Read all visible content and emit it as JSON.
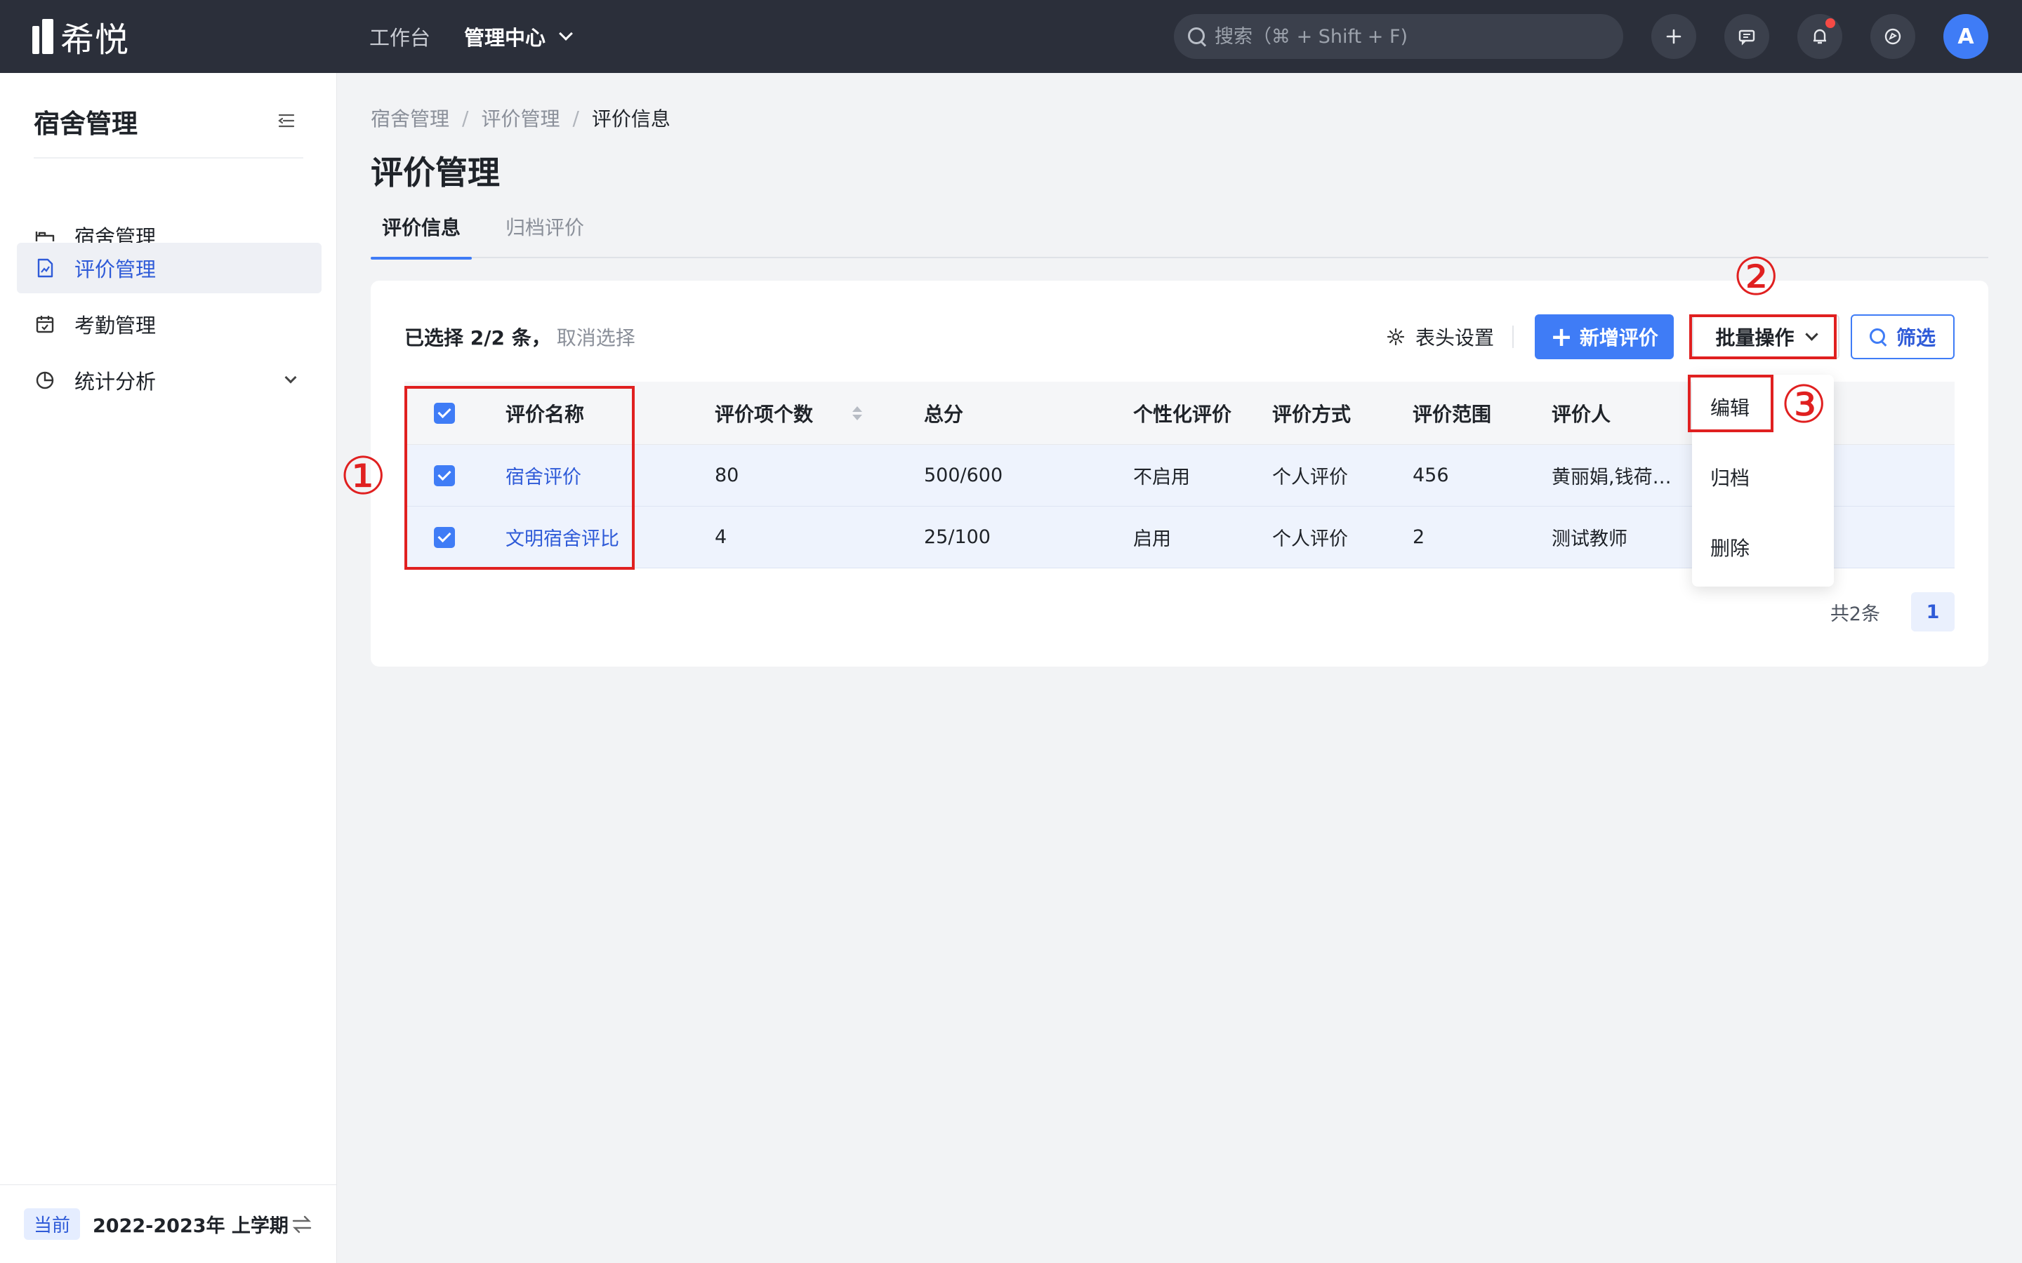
{
  "topbar": {
    "logo_text": "希悦",
    "nav": [
      {
        "label": "工作台"
      },
      {
        "label": "管理中心"
      }
    ],
    "search_placeholder": "搜索（⌘ + Shift + F)",
    "avatar_letter": "A",
    "has_notification": true
  },
  "sidebar": {
    "title": "宿舍管理",
    "items": [
      {
        "label": "宿舍管理",
        "icon": "bed-icon"
      },
      {
        "label": "评价管理",
        "icon": "chart-doc-icon",
        "active": true
      },
      {
        "label": "考勤管理",
        "icon": "calendar-icon"
      },
      {
        "label": "统计分析",
        "icon": "pie-chart-icon"
      }
    ],
    "term_badge": "当前",
    "term_text": "2022-2023年 上学期"
  },
  "main": {
    "breadcrumb": [
      "宿舍管理",
      "评价管理",
      "评价信息"
    ],
    "breadcrumb_sep": "/",
    "title": "评价管理",
    "tabs": [
      {
        "label": "评价信息",
        "active": true
      },
      {
        "label": "归档评价"
      }
    ]
  },
  "card": {
    "selection_prefix": "已选择 2/2 条，",
    "cancel_selection": "取消选择",
    "settings_label": "表头设置",
    "add_label": "新增评价",
    "batch_label": "批量操作",
    "filter_label": "筛选",
    "table": {
      "headers": [
        "评价名称",
        "评价项个数",
        "总分",
        "个性化评价",
        "评价方式",
        "评价范围",
        "评价人"
      ],
      "rows": [
        [
          "宿舍评价",
          "80",
          "500/600",
          "不启用",
          "个人评价",
          "456",
          "黄丽娟,钱荷…"
        ],
        [
          "文明宿舍评比",
          "4",
          "25/100",
          "启用",
          "个人评价",
          "2",
          "测试教师"
        ]
      ]
    },
    "total_label": "共2条",
    "page": "1",
    "batch_menu": [
      "编辑",
      "归档",
      "删除"
    ]
  },
  "annotations": [
    "①",
    "②",
    "③"
  ],
  "colors": {
    "topbar": "#2b2f3a",
    "primary": "#3f7cf6",
    "link": "#2f5bd8",
    "annotation_red": "#e02020",
    "selected_row": "#eef3fd"
  }
}
